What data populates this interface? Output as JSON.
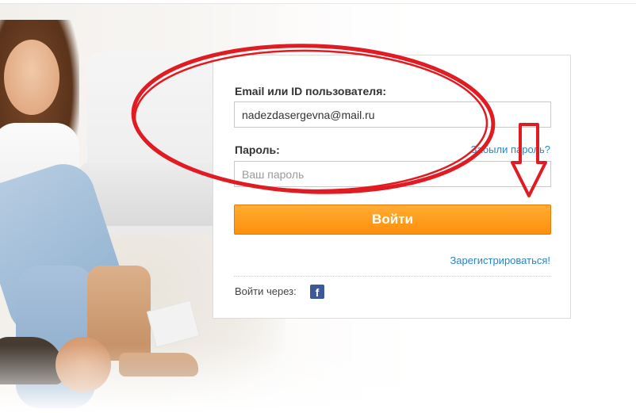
{
  "login": {
    "email_label": "Email или ID пользователя:",
    "email_value": "nadezdasergevna@mail.ru",
    "password_label": "Пароль:",
    "password_placeholder": "Ваш пароль",
    "forgot_link": "Забыли пароль?",
    "submit_label": "Войти",
    "register_link": "Зарегистрироваться!",
    "login_via_label": "Войти через:"
  },
  "social": {
    "facebook_glyph": "f",
    "icon": "facebook-icon"
  },
  "colors": {
    "accent_orange": "#fd8f0c",
    "link_blue": "#2a86c6",
    "annotation_red": "#e01b22",
    "facebook_blue": "#3b5998"
  }
}
